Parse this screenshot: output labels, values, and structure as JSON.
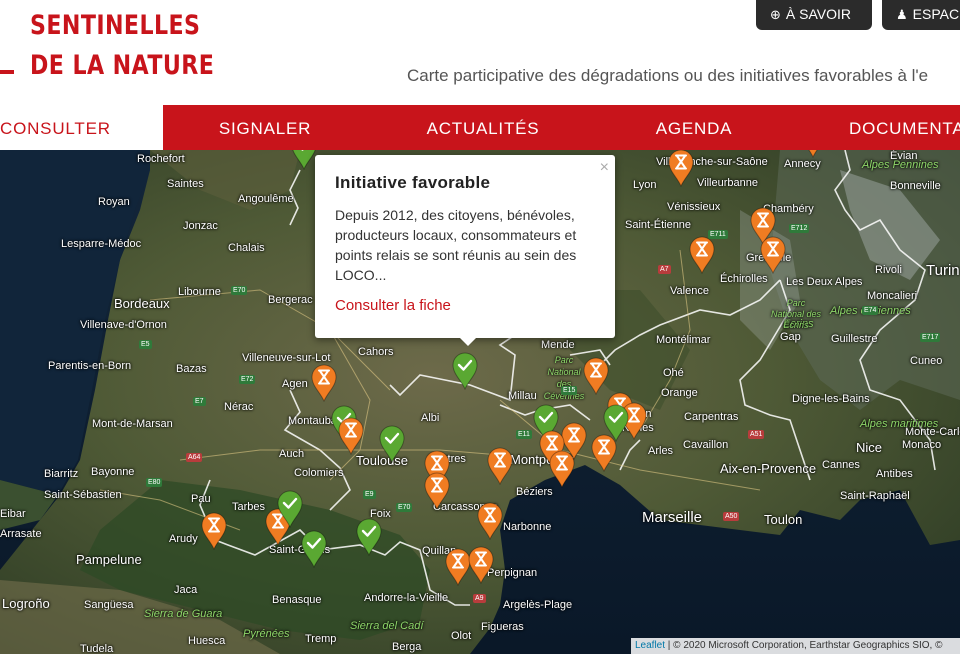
{
  "header": {
    "logo_line1": "SENTINELLES",
    "logo_line2": "DE LA NATURE",
    "tagline": "Carte participative des dégradations ou des initiatives favorables à l'e",
    "buttons": [
      {
        "icon": "plus-circle-icon",
        "label": "À SAVOIR"
      },
      {
        "icon": "user-icon",
        "label": "ESPAC"
      }
    ]
  },
  "nav": {
    "items": [
      {
        "label": "CONSULTER",
        "active": true
      },
      {
        "label": "SIGNALER",
        "active": false
      },
      {
        "label": "ACTUALITÉS",
        "active": false
      },
      {
        "label": "AGENDA",
        "active": false
      },
      {
        "label": "DOCUMENTA",
        "active": false
      }
    ]
  },
  "popup": {
    "title": "Initiative favorable",
    "body": "Depuis 2012, des citoyens, bénévoles, producteurs locaux, consommateurs et points relais se sont réunis au sein des LOCO...",
    "link": "Consulter la fiche",
    "close": "×"
  },
  "map": {
    "colors": {
      "pending": "#f07c22",
      "favorable": "#5aa832"
    },
    "places": [
      "Rochefort",
      "Saintes",
      "Angoulême",
      "Royan",
      "Jonzac",
      "Lesparre-Médoc",
      "Chalais",
      "Libourne",
      "Bordeaux",
      "Bergerac",
      "Villenave-d'Ornon",
      "Parentis-en-Born",
      "Bazas",
      "Villeneuve-sur-Lot",
      "Cahors",
      "Agen",
      "Montauban",
      "Nérac",
      "Mont-de-Marsan",
      "Albi",
      "Auch",
      "Colomiers",
      "Toulouse",
      "Castres",
      "Biarritz",
      "Bayonne",
      "Saint-Sébastien",
      "Pau",
      "Tarbes",
      "Arudy",
      "Saint-Girons",
      "Foix",
      "Eibar",
      "Arrasate",
      "Pampelune",
      "Logroño",
      "Sangüesa",
      "Jaca",
      "Benasque",
      "Andorre-la-Vieille",
      "Huesca",
      "Tudela",
      "Tremp",
      "Berga",
      "Olot",
      "Figueras",
      "Argelès-Plage",
      "Perpignan",
      "Quillan",
      "Carcassonne",
      "Narbonne",
      "Béziers",
      "Montpellier",
      "Millau",
      "Mende",
      "Nîmes",
      "Arles",
      "Avignon",
      "Cavaillon",
      "Carpentras",
      "Orange",
      "Montélimar",
      "Valence",
      "Saint-Étienne",
      "Lyon",
      "Villeurbanne",
      "Vénissieux",
      "Villefranche-sur-Saône",
      "Annecy",
      "Chambéry",
      "Grenoble",
      "Échirolles",
      "Les Deux Alpes",
      "Gap",
      "Guillestre",
      "Digne-les-Bains",
      "Aix-en-Provence",
      "Marseille",
      "Toulon",
      "Nice",
      "Cannes",
      "Antibes",
      "Saint-Raphaël",
      "Monaco",
      "Monte-Carlo",
      "Rivoli",
      "Turin",
      "Moncalieri",
      "Cuneo",
      "Évian",
      "Bonneville",
      "Ohé",
      "Ecrins"
    ],
    "regions": [
      "Alpes Pennines",
      "Alpes cottiennes",
      "Alpes maritimes",
      "Parc National des Cévennes",
      "Parc National des Écrins",
      "Pyrénées",
      "Sierra de Guara",
      "Sierra del Cadí"
    ],
    "roads": [
      "E70",
      "E5",
      "E7",
      "E72",
      "E80",
      "E9",
      "E11",
      "E15",
      "E711",
      "E712",
      "A7",
      "A9",
      "A50",
      "A51",
      "E717",
      "E74",
      "A64",
      "E70 "
    ],
    "attribution_link": "Leaflet",
    "attribution_text": " | © 2020 Microsoft Corporation, Earthstar Geographics SIO, ©"
  }
}
